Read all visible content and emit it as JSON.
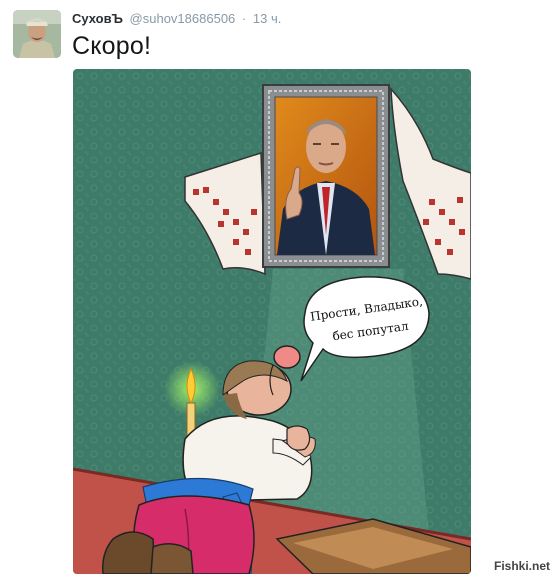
{
  "tweet": {
    "display_name": "СуховЪ",
    "handle": "@suhov18686506",
    "separator": "·",
    "time": "13 ч.",
    "text": "Скоро!"
  },
  "image": {
    "bubble_line1": "Прости, Владыко,",
    "bubble_line2": "бес попутал"
  },
  "watermark": "Fishki.net",
  "colors": {
    "wall": "#3e7a68",
    "floor": "#c1524a",
    "frame": "#8a8e90",
    "towel_pattern": "#b8342c"
  }
}
